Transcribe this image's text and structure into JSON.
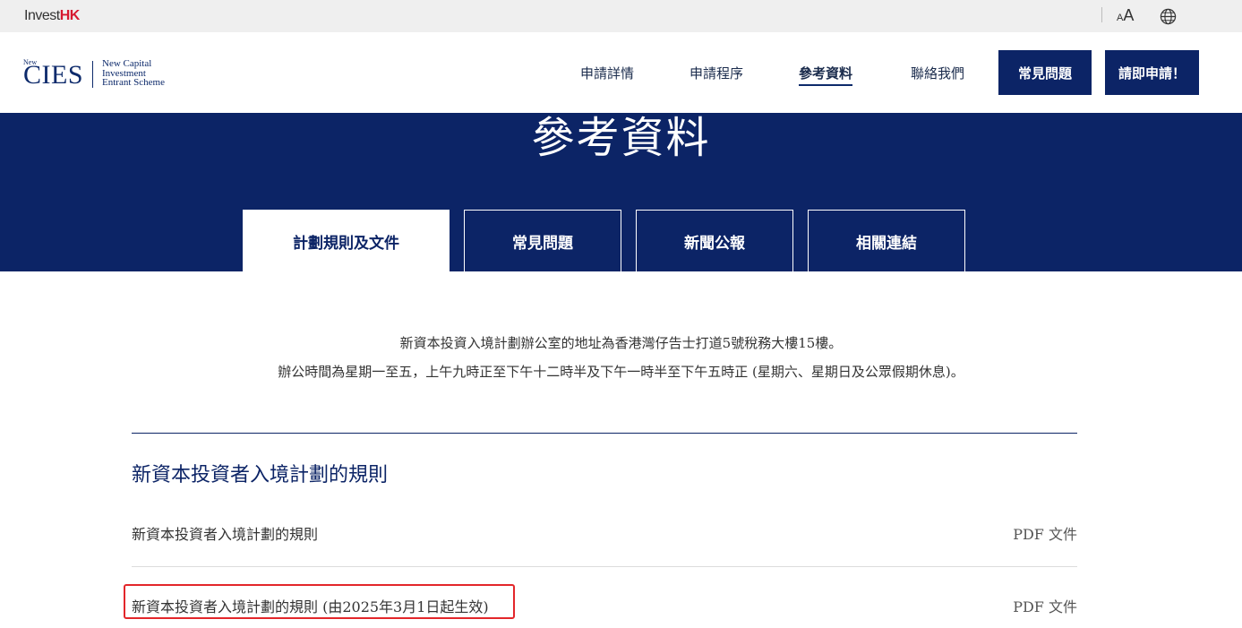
{
  "topbar": {
    "brand_invest": "Invest",
    "brand_hk": "HK",
    "font_small": "A",
    "font_large": "A",
    "language_icon": "globe-icon"
  },
  "header": {
    "logo": {
      "new": "New",
      "cies": "CIES",
      "line1": "New Capital",
      "line2": "Investment",
      "line3": "Entrant Scheme"
    },
    "nav": [
      {
        "label": "申請詳情",
        "active": false
      },
      {
        "label": "申請程序",
        "active": false
      },
      {
        "label": "參考資料",
        "active": true
      },
      {
        "label": "聯絡我們",
        "active": false
      }
    ],
    "faq_button": "常見問題",
    "apply_button": "請即申請！"
  },
  "hero": {
    "title": "參考資料",
    "tabs": [
      {
        "label": "計劃規則及文件",
        "active": true
      },
      {
        "label": "常見問題",
        "active": false
      },
      {
        "label": "新聞公報",
        "active": false
      },
      {
        "label": "相關連結",
        "active": false
      }
    ]
  },
  "info": {
    "address": "新資本投資入境計劃辦公室的地址為香港灣仔告士打道5號稅務大樓15樓。",
    "hours": "辦公時間為星期一至五，上午九時正至下午十二時半及下午一時半至下午五時正 (星期六、星期日及公眾假期休息)。"
  },
  "section": {
    "title": "新資本投資者入境計劃的規則",
    "documents": [
      {
        "title": "新資本投資者入境計劃的規則",
        "type": "PDF 文件"
      },
      {
        "title": "新資本投資者入境計劃的規則 (由2025年3月1日起生效)",
        "type": "PDF 文件"
      }
    ]
  },
  "colors": {
    "navy": "#0c2466",
    "brand_red": "#d6182f",
    "highlight_red": "#e3262a"
  }
}
